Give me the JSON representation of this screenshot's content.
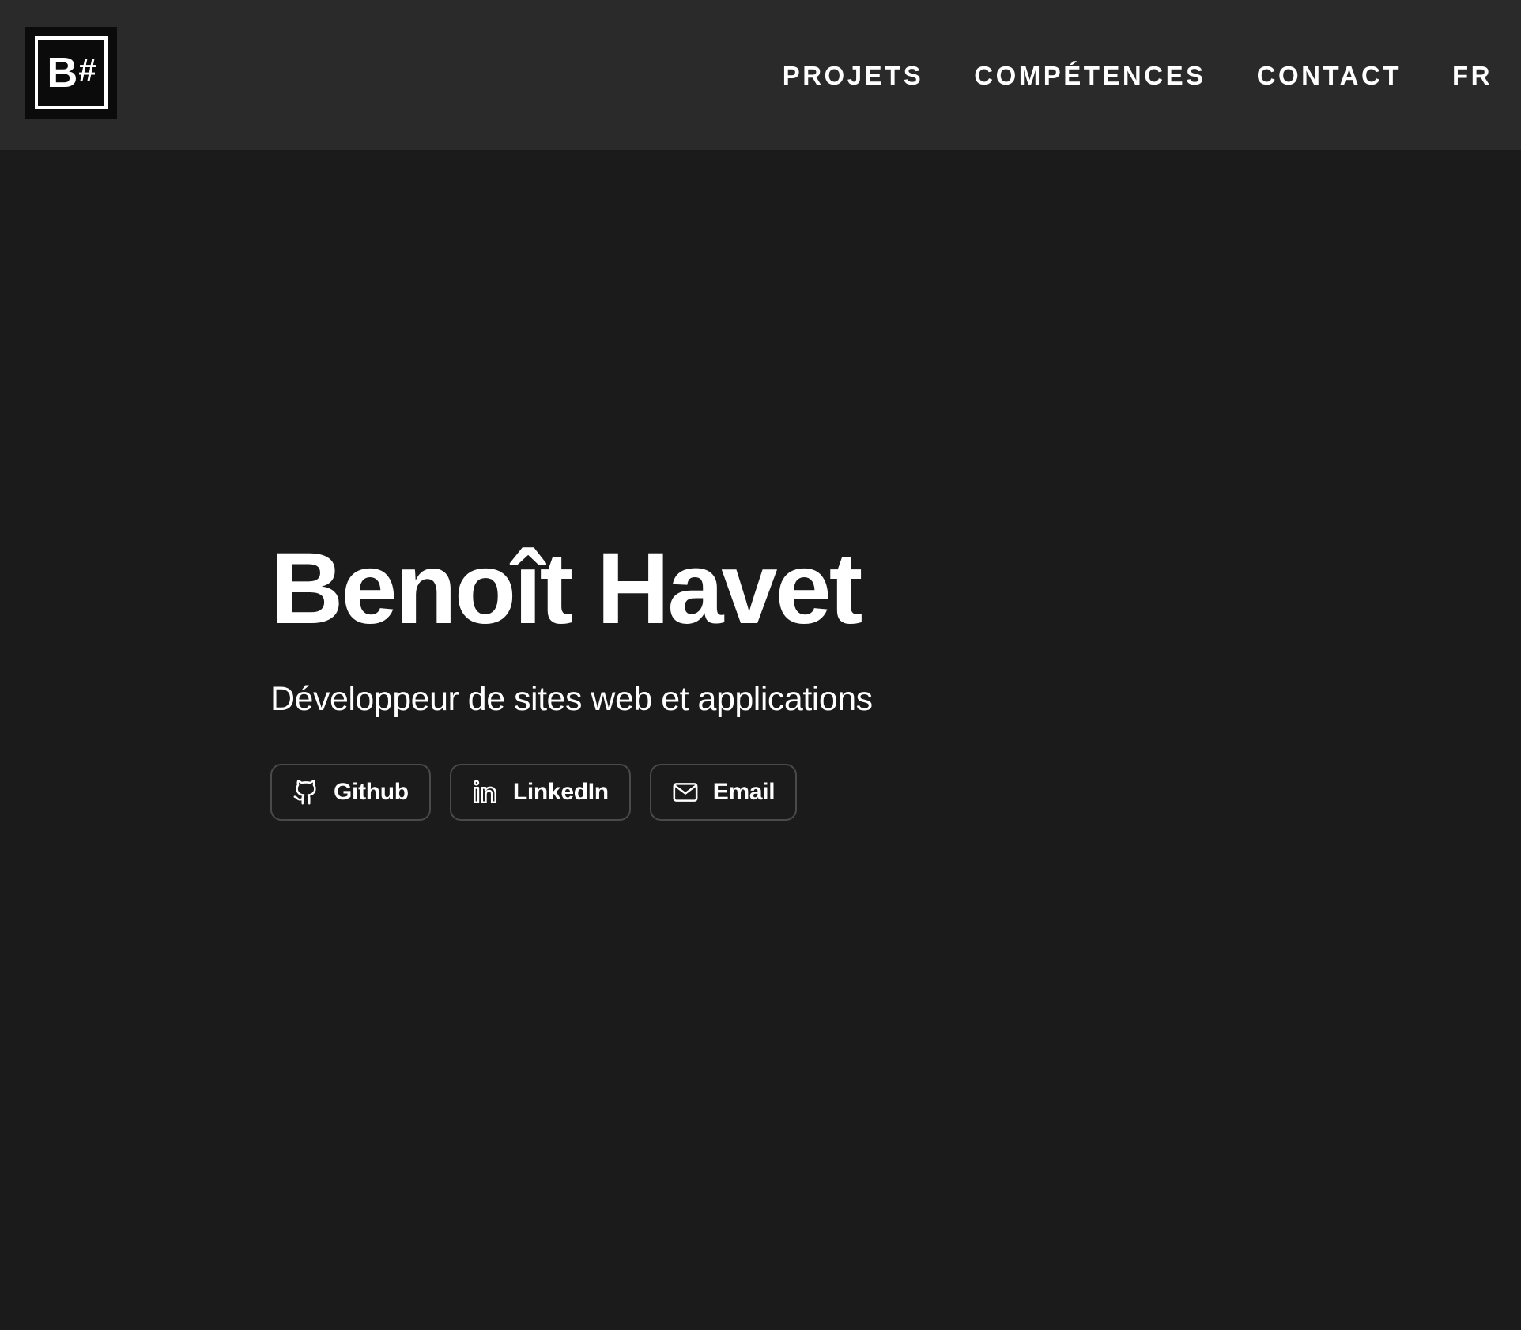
{
  "header": {
    "logo": {
      "letter": "B",
      "symbol": "#"
    },
    "nav": {
      "projects_label": "PROJETS",
      "skills_label": "COMPÉTENCES",
      "contact_label": "CONTACT",
      "language_label": "FR"
    }
  },
  "hero": {
    "name": "Benoît Havet",
    "subtitle": "Développeur de sites web et applications",
    "buttons": [
      {
        "label": "Github",
        "icon": "github-icon"
      },
      {
        "label": "LinkedIn",
        "icon": "linkedin-icon"
      },
      {
        "label": "Email",
        "icon": "mail-icon"
      }
    ]
  },
  "colors": {
    "page_background": "#1b1b1b",
    "header_background": "#2a2a2a",
    "logo_background": "#0b0b0b",
    "text": "#ffffff",
    "button_border": "#4a4a4a"
  }
}
